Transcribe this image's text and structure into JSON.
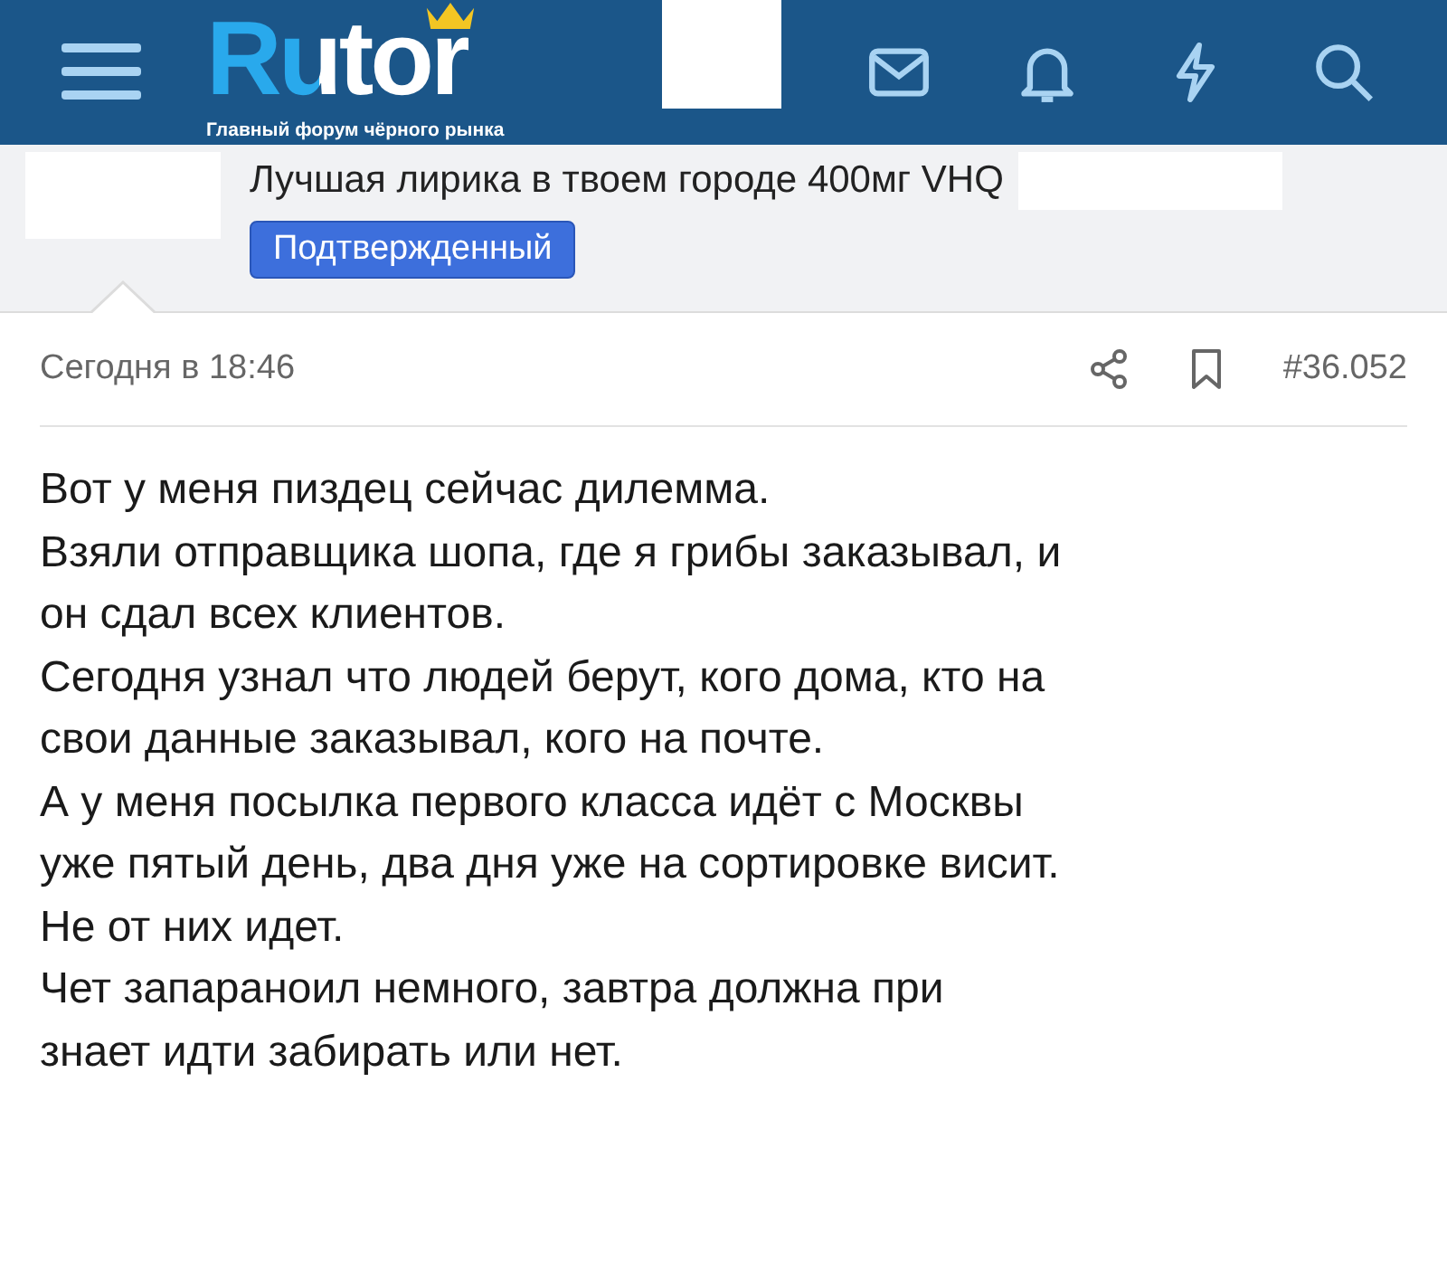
{
  "header": {
    "logo": "Rutor",
    "tagline": "Главный форум чёрного рынка"
  },
  "author": {
    "title": "Лучшая лирика в твоем городе 400мг VHQ",
    "badge": "Подтвержденный"
  },
  "post": {
    "date": "Сегодня в 18:46",
    "number": "#36.052",
    "lines": [
      "Вот у меня пиздец сейчас дилемма.",
      "Взяли отправщика шопа, где я грибы заказывал, и",
      "он сдал всех клиентов.",
      "Сегодня узнал что людей берут, кого дома, кто на",
      "свои данные заказывал, кого на почте.",
      "А у меня посылка первого класса идёт с Москвы",
      "уже пятый день, два дня уже на сортировке висит.",
      "Не от них идет.",
      "Чет запараноил немного, завтра должна при",
      "знает идти забирать или нет."
    ]
  }
}
